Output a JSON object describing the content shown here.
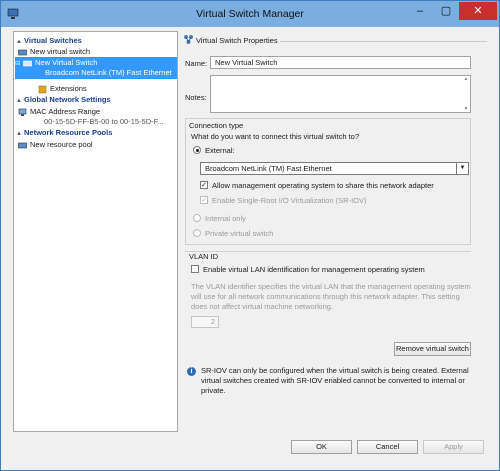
{
  "window": {
    "title": "Virtual Switch Manager"
  },
  "sidebar": {
    "virtual_switches_header": "Virtual Switches",
    "new_virtual_switch_link": "New virtual switch",
    "selected_switch_name": "New Virtual Switch",
    "selected_switch_adapter": "Broadcom NetLink (TM) Fast Ethernet",
    "extensions": "Extensions",
    "global_settings_header": "Global Network Settings",
    "mac_address_range": "MAC Address Range",
    "mac_address_value": "00-15-5D-FF-B5-00 to 00-15-5D-F...",
    "resource_pools_header": "Network Resource Pools",
    "new_resource_pool": "New resource pool"
  },
  "props": {
    "header": "Virtual Switch Properties",
    "name_label": "Name:",
    "name_value": "New Virtual Switch",
    "notes_label": "Notes:",
    "notes_value": "",
    "connection_type_label": "Connection type",
    "connection_question": "What do you want to connect this virtual switch to?",
    "external_label": "External:",
    "adapter_selected": "Broadcom NetLink (TM) Fast Ethernet",
    "allow_mgmt_label": "Allow management operating system to share this network adapter",
    "sriov_label": "Enable Single-Root I/O Virtualization (SR-IOV)",
    "internal_label": "Internal only",
    "private_label": "Private virtual switch",
    "vlan_header": "VLAN ID",
    "vlan_checkbox_label": "Enable virtual LAN identification for management operating system",
    "vlan_description": "The VLAN identifier specifies the virtual LAN that the management operating system will use for all network communications through this network adapter. This setting does not affect virtual machine networking.",
    "vlan_value": "2",
    "remove_button": "Remove virtual switch",
    "sriov_note": "SR-IOV can only be configured when the virtual switch is being created. External virtual switches created with SR-IOV enabled cannot be converted to internal or private."
  },
  "footer": {
    "ok": "OK",
    "cancel": "Cancel",
    "apply": "Apply"
  },
  "state": {
    "connection_type": "External",
    "allow_management_os": true,
    "sriov_enabled": true,
    "vlan_enabled": false
  },
  "colors": {
    "titlebar": "#7aaee0",
    "selection": "#3399ff",
    "header_text": "#1a3e8c",
    "close_button": "#c7312a"
  },
  "icons": [
    "switch-icon",
    "puzzle-icon",
    "network-icon",
    "pool-icon",
    "info-icon"
  ]
}
